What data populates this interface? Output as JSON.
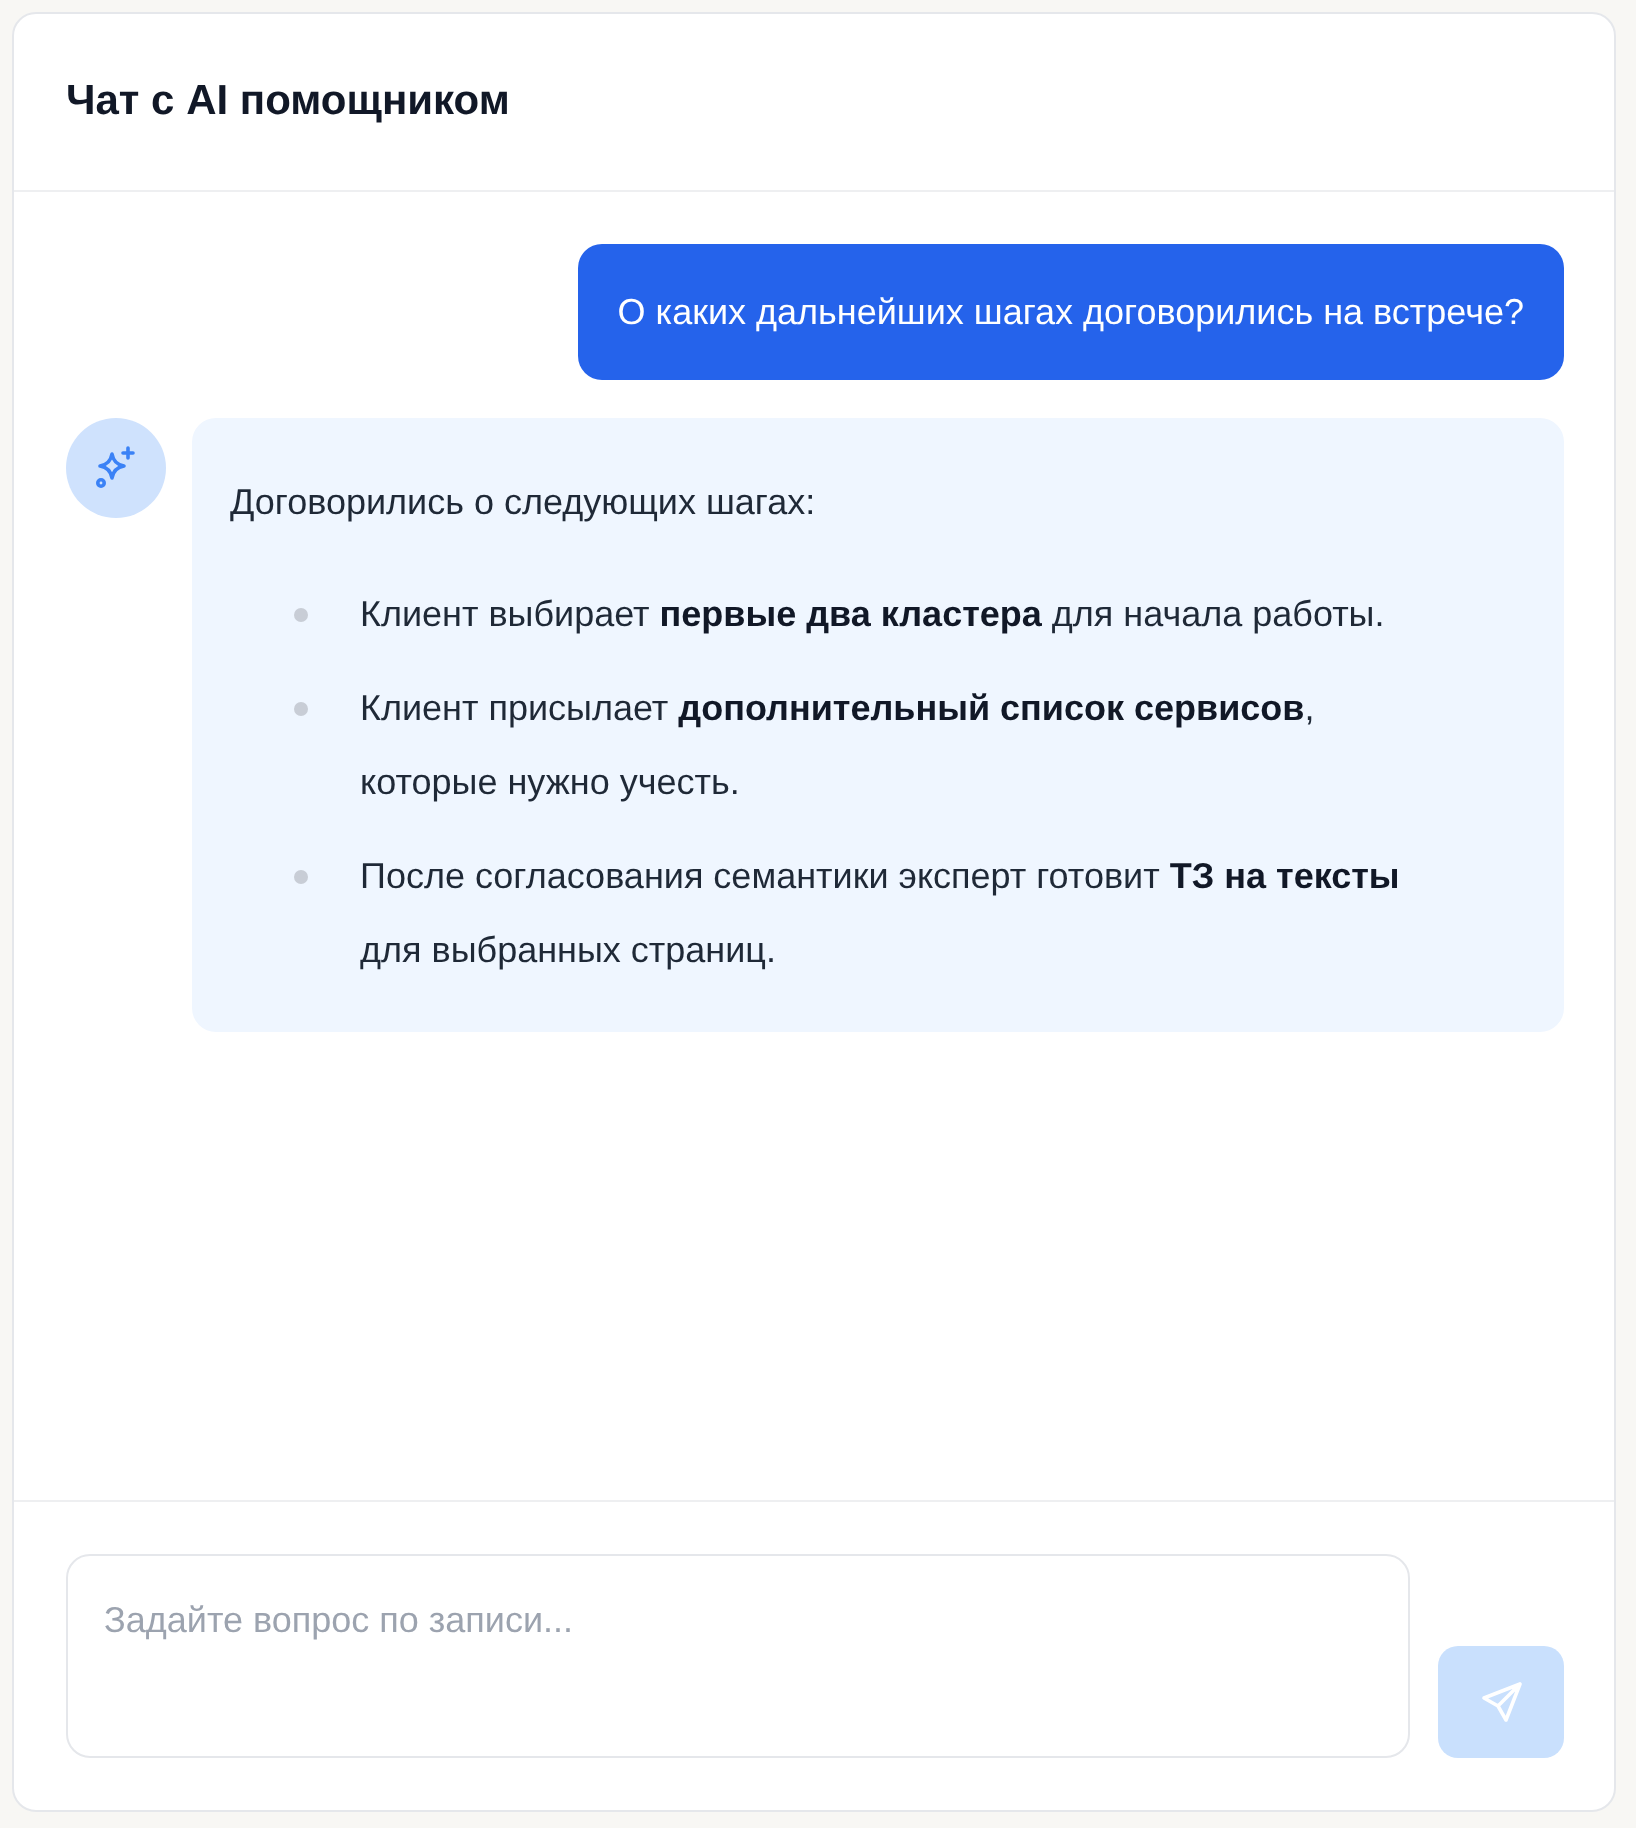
{
  "header": {
    "title": "Чат с AI помощником"
  },
  "messages": [
    {
      "kind": "user",
      "text": "О каких дальнейших шагах договорились на встрече?"
    },
    {
      "kind": "assistant",
      "intro": "Договорились о следующих шагах:",
      "items": [
        "Клиент выбирает **первые два кластера** для начала работы.",
        "Клиент присылает **дополнительный список сервисов**, которые нужно учесть.",
        "После согласования семантики эксперт готовит **ТЗ на тексты** для выбранных страниц."
      ]
    }
  ],
  "composer": {
    "placeholder": "Задайте вопрос по записи...",
    "send_disabled": true
  }
}
